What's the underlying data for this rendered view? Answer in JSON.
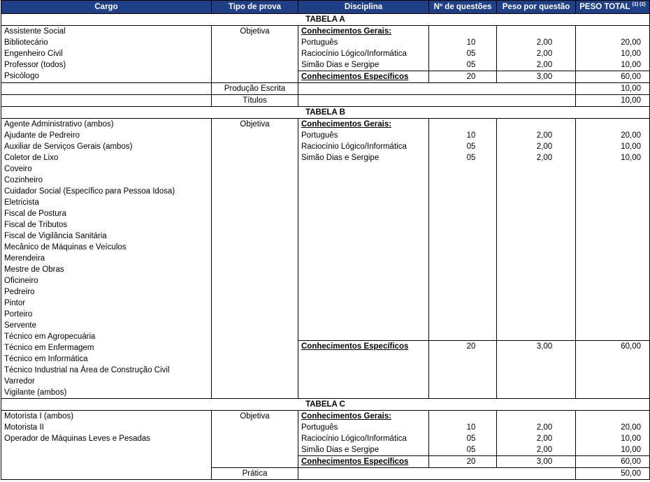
{
  "headers": {
    "cargo": "Cargo",
    "tipo": "Tipo de prova",
    "disciplina": "Disciplina",
    "questoes": "Nº de questões",
    "peso": "Peso por questão",
    "total": "PESO TOTAL",
    "total_sup": "(1) (2)"
  },
  "tabela_a": {
    "title": "TABELA A",
    "cargos": [
      "Assistente Social",
      "Bibliotecário",
      "Engenheiro Civil",
      "Professor (todos)",
      "Psicólogo"
    ],
    "tipo": "Objetiva",
    "gerais": "Conhecimentos Gerais:",
    "disc": [
      "Português",
      "Raciocínio Lógico/Informática",
      "Simão Dias e Sergipe"
    ],
    "quest": [
      "10",
      "05",
      "05"
    ],
    "peso": [
      "2,00",
      "2,00",
      "2,00"
    ],
    "total": [
      "20,00",
      "10,00",
      "10,00"
    ],
    "especificos": "Conhecimentos Específicos",
    "esp_quest": "20",
    "esp_peso": "3,00",
    "esp_total": "60,00",
    "extra1_tipo": "Produção Escrita",
    "extra1_total": "10,00",
    "extra2_tipo": "Títulos",
    "extra2_total": "10,00"
  },
  "tabela_b": {
    "title": "TABELA B",
    "cargos": [
      "Agente Administrativo (ambos)",
      "Ajudante de Pedreiro",
      "Auxiliar de Serviços Gerais (ambos)",
      "Coletor de Lixo",
      "Coveiro",
      "Cozinheiro",
      "Cuidador Social (Específico para Pessoa Idosa)",
      "Eletricista",
      "Fiscal de Postura",
      "Fiscal de Tributos",
      "Fiscal de Vigilância Sanitária",
      "Mecânico de Máquinas e Veículos",
      "Merendeira",
      "Mestre de Obras",
      "Oficineiro",
      "Pedreiro",
      "Pintor",
      "Porteiro",
      "Servente",
      "Técnico em Agropecuária",
      "Técnico em Enfermagem",
      "Técnico em Informática",
      "Técnico Industrial na Área de Construção Civil",
      "Varredor",
      "Vigilante (ambos)"
    ],
    "tipo": "Objetiva",
    "gerais": "Conhecimentos Gerais:",
    "disc": [
      "Português",
      "Raciocínio Lógico/Informática",
      "Simão Dias e Sergipe"
    ],
    "quest": [
      "10",
      "05",
      "05"
    ],
    "peso": [
      "2,00",
      "2,00",
      "2,00"
    ],
    "total": [
      "20,00",
      "10,00",
      "10,00"
    ],
    "especificos": "Conhecimentos Específicos",
    "esp_quest": "20",
    "esp_peso": "3,00",
    "esp_total": "60,00"
  },
  "tabela_c": {
    "title": "TABELA C",
    "cargos": [
      "Motorista I (ambos)",
      "Motorista II",
      "Operador de Máquinas Leves e Pesadas"
    ],
    "tipo": "Objetiva",
    "gerais": "Conhecimentos Gerais:",
    "disc": [
      "Português",
      "Raciocínio Lógico/Informática",
      "Simão Dias e Sergipe"
    ],
    "quest": [
      "10",
      "05",
      "05"
    ],
    "peso": [
      "2,00",
      "2,00",
      "2,00"
    ],
    "total": [
      "20,00",
      "10,00",
      "10,00"
    ],
    "especificos": "Conhecimentos Específicos",
    "esp_quest": "20",
    "esp_peso": "3,00",
    "esp_total": "60,00",
    "extra1_tipo": "Prática",
    "extra1_total": "50,00"
  }
}
